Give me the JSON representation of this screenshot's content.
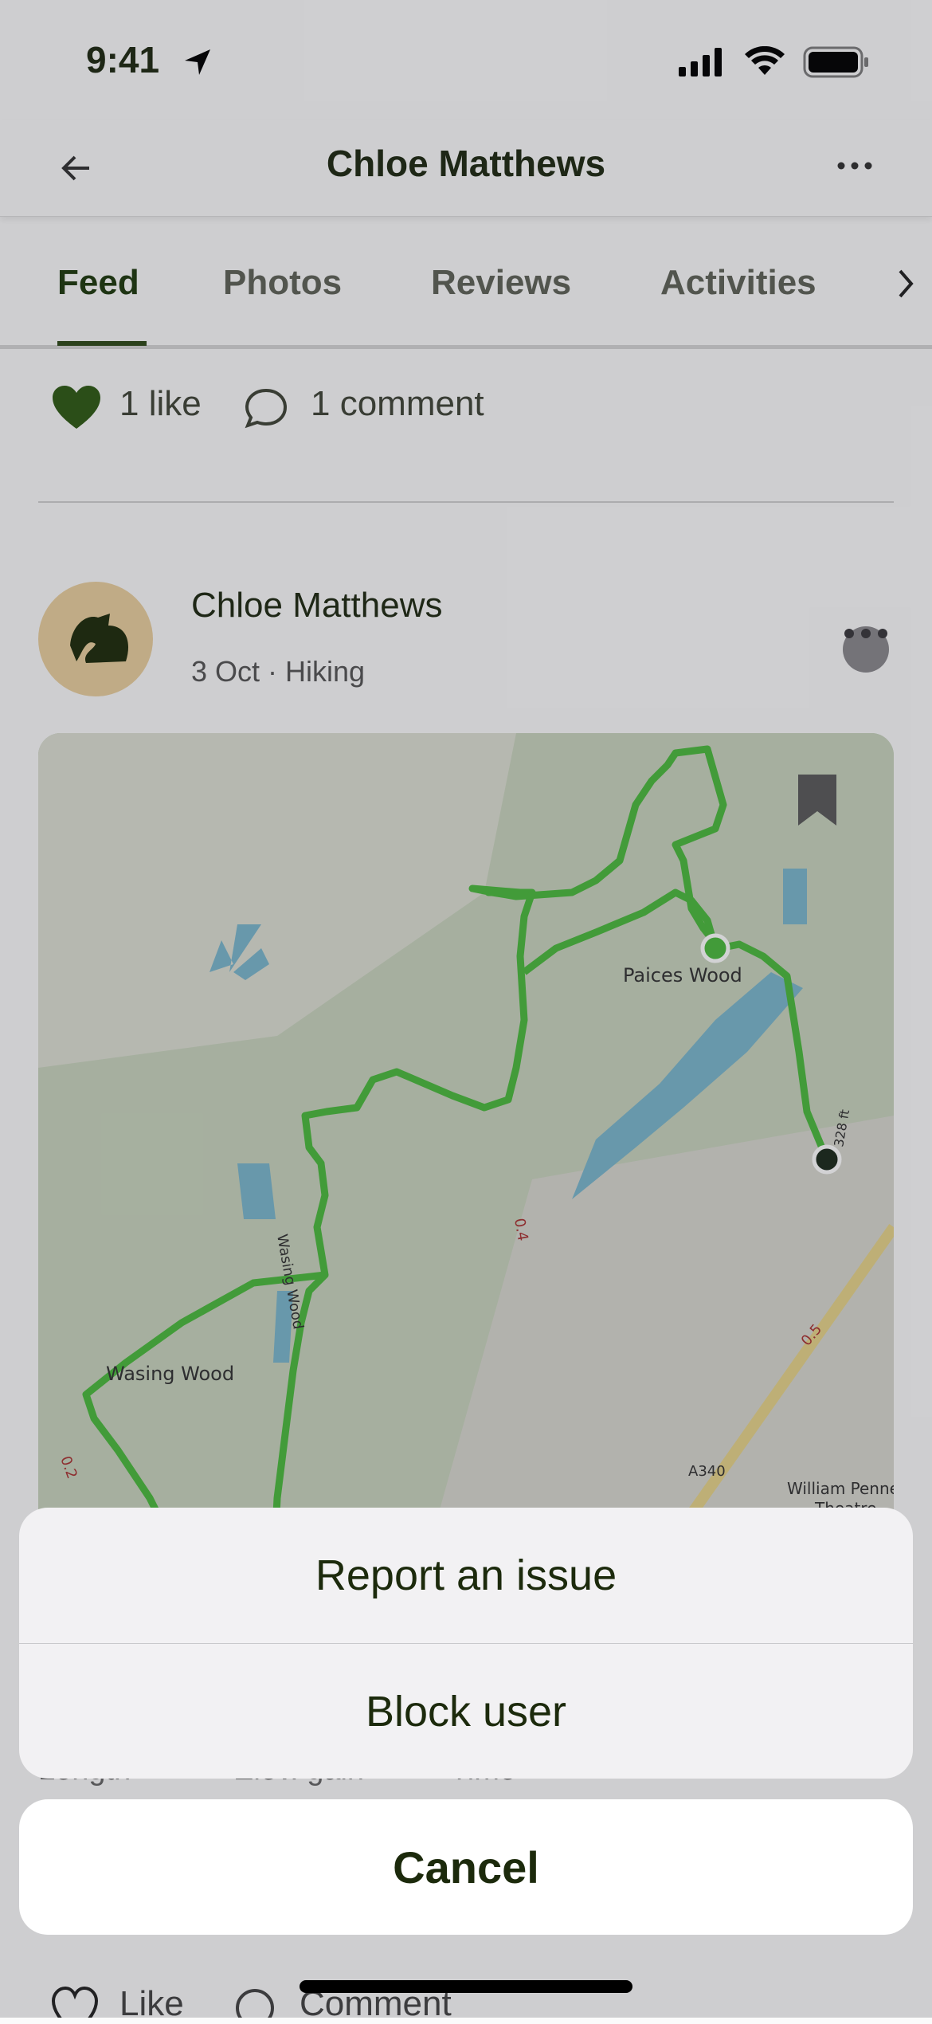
{
  "status_bar": {
    "time": "9:41"
  },
  "header": {
    "title": "Chloe Matthews"
  },
  "tabs": [
    {
      "label": "Feed",
      "active": true
    },
    {
      "label": "Photos"
    },
    {
      "label": "Reviews"
    },
    {
      "label": "Activities"
    }
  ],
  "engagement": {
    "likes": "1 like",
    "comments": "1 comment"
  },
  "post": {
    "author": "Chloe Matthews",
    "subtitle": "3 Oct · Hiking",
    "map": {
      "labels": {
        "paices": "Paices Wood",
        "wasing": "Wasing Wood",
        "wasing_v": "Wasing Wood",
        "penney": "William Penney",
        "theatre": "Theatre",
        "road": "A340",
        "d1": "0.4",
        "d2": "0.5",
        "d3": "0.2",
        "elev": "328 ft"
      }
    },
    "stats": {
      "length": "Length",
      "elev": "Elev. gain",
      "time": "Time"
    },
    "actions": {
      "like": "Like",
      "comment": "Comment"
    }
  },
  "action_sheet": {
    "options": [
      "Report an issue",
      "Block user"
    ],
    "cancel": "Cancel"
  },
  "colors": {
    "accent": "#2f4a1a",
    "route": "#4cbb3e",
    "water": "#7bb7cc"
  }
}
